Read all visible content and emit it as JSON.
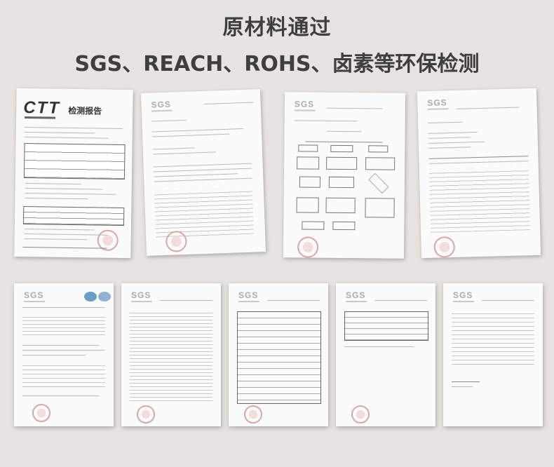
{
  "header": {
    "title_line1": "原材料通过",
    "title_line2": "SGS、REACH、ROHS、卤素等环保检测"
  },
  "documents": {
    "ctt_report": {
      "logo": "CTT",
      "report_title": "检测报告"
    },
    "sgs_logo": "SGS"
  }
}
